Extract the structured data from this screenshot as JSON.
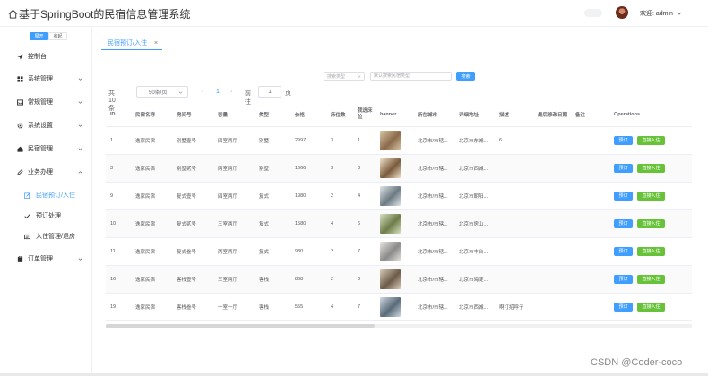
{
  "header": {
    "title": "基于SpringBoot的民宿信息管理系统",
    "welcome": "欢迎: admin"
  },
  "sidebar": {
    "open_label": "展开",
    "close_label": "收起",
    "items": [
      {
        "label": "控制台",
        "icon": "send-icon"
      },
      {
        "label": "系统管理",
        "icon": "grid-icon"
      },
      {
        "label": "常规管理",
        "icon": "tray-icon"
      },
      {
        "label": "系统设置",
        "icon": "gear-icon"
      },
      {
        "label": "民宿管理",
        "icon": "home-icon"
      },
      {
        "label": "业务办理",
        "icon": "pen-icon"
      }
    ],
    "sub_items": [
      {
        "label": "民宿预订/入住",
        "icon": "edit-icon"
      },
      {
        "label": "预订处理",
        "icon": "check-icon"
      },
      {
        "label": "入住管理/退房",
        "icon": "card-icon"
      }
    ],
    "last_item": {
      "label": "订单管理",
      "icon": "clipboard-icon"
    }
  },
  "tab": {
    "label": "民宿预订/入住",
    "close": "×"
  },
  "search": {
    "type_placeholder": "搜索类型",
    "input_placeholder": "默认搜索民宿类型",
    "button": "搜索"
  },
  "pager": {
    "total": "共 10 条",
    "page_size": "50条/页",
    "prev": "‹",
    "current": "1",
    "next": "›",
    "goto": "前往",
    "goto_value": "1",
    "unit": "页"
  },
  "table": {
    "headers": [
      "ID",
      "民宿名称",
      "房间号",
      "容量",
      "类型",
      "价格",
      "床位数",
      "我选床位",
      "banner",
      "所在城市",
      "详细地址",
      "描述",
      "最后修改日期",
      "备注",
      "Operations"
    ],
    "rows": [
      {
        "id": "1",
        "name": "逸家民宿",
        "room": "别墅壹号",
        "cap": "四室两厅",
        "type": "别墅",
        "price": "2997",
        "beds": "3",
        "sel": "1",
        "city": "北京市/市辖...",
        "addr": "北京市东城...",
        "desc": "6",
        "date": "",
        "note": ""
      },
      {
        "id": "3",
        "name": "逸家民宿",
        "room": "别墅贰号",
        "cap": "两室两厅",
        "type": "别墅",
        "price": "1666",
        "beds": "3",
        "sel": "3",
        "city": "北京市/市辖...",
        "addr": "北京市西城...",
        "desc": "",
        "date": "",
        "note": ""
      },
      {
        "id": "9",
        "name": "逸家民宿",
        "room": "复式壹号",
        "cap": "四室两厅",
        "type": "复式",
        "price": "1980",
        "beds": "2",
        "sel": "4",
        "city": "北京市/市辖...",
        "addr": "北京市朝阳...",
        "desc": "",
        "date": "",
        "note": ""
      },
      {
        "id": "10",
        "name": "逸家民宿",
        "room": "复式贰号",
        "cap": "三室两厅",
        "type": "复式",
        "price": "1580",
        "beds": "4",
        "sel": "6",
        "city": "北京市/市辖...",
        "addr": "北京市房山...",
        "desc": "",
        "date": "",
        "note": ""
      },
      {
        "id": "11",
        "name": "逸家民宿",
        "room": "复式叁号",
        "cap": "两室两厅",
        "type": "复式",
        "price": "980",
        "beds": "2",
        "sel": "7",
        "city": "北京市/市辖...",
        "addr": "北京市丰台...",
        "desc": "",
        "date": "",
        "note": ""
      },
      {
        "id": "16",
        "name": "逸家民宿",
        "room": "客栈壹号",
        "cap": "三室两厅",
        "type": "客栈",
        "price": "868",
        "beds": "2",
        "sel": "8",
        "city": "北京市/市辖...",
        "addr": "北京市海淀...",
        "desc": "",
        "date": "",
        "note": ""
      },
      {
        "id": "19",
        "name": "逸家民宿",
        "room": "客栈叁号",
        "cap": "一室一厅",
        "type": "客栈",
        "price": "555",
        "beds": "4",
        "sel": "7",
        "city": "北京市/市辖...",
        "addr": "北京市西城...",
        "desc": "啊打招呼子",
        "date": "",
        "note": ""
      }
    ],
    "book_label": "预订",
    "checkin_label": "直接入住"
  },
  "watermark": "CSDN @Coder-coco",
  "colors": {
    "primary": "#409eff",
    "success": "#67c23a"
  }
}
